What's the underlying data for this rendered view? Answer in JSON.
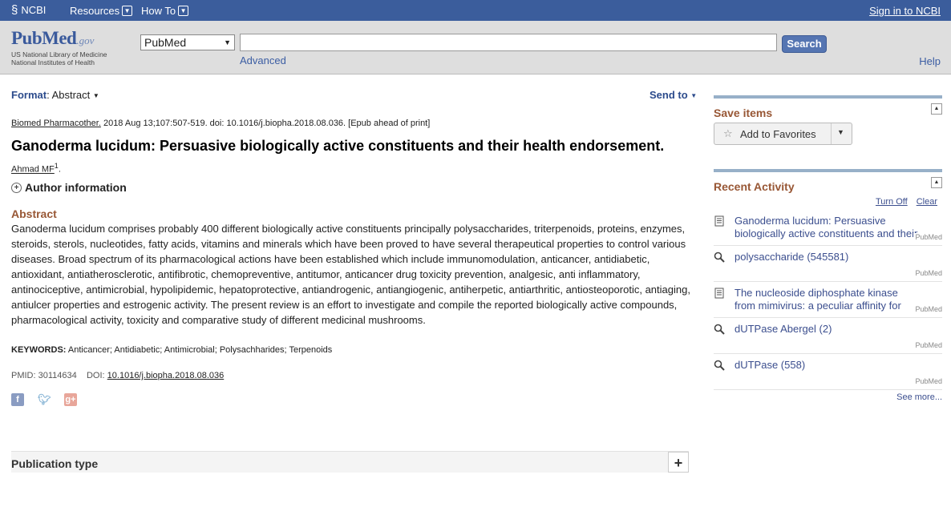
{
  "ncbi_bar": {
    "logo": "NCBI",
    "nav": [
      "Resources",
      "How To"
    ],
    "signin": "Sign in to NCBI"
  },
  "search": {
    "logo_pub": "Pub",
    "logo_med": "Med",
    "logo_gov": ".gov",
    "logo_sub1": "US National Library of Medicine",
    "logo_sub2": "National Institutes of Health",
    "database": "PubMed",
    "query": "",
    "button": "Search",
    "advanced": "Advanced",
    "help": "Help"
  },
  "article": {
    "format_label": "Format",
    "format_value": "Abstract",
    "send_to": "Send to",
    "journal": "Biomed Pharmacother.",
    "citation_rest": "2018 Aug 13;107:507-519. doi: 10.1016/j.biopha.2018.08.036. [Epub ahead of print]",
    "title": "Ganoderma lucidum: Persuasive biologically active constituents and their health endorsement.",
    "author": "Ahmad MF",
    "author_sup": "1",
    "author_info": "Author information",
    "abstract_heading": "Abstract",
    "abstract_text": "Ganoderma lucidum comprises probably 400 different biologically active constituents principally polysaccharides, triterpenoids, proteins, enzymes, steroids, sterols, nucleotides, fatty acids, vitamins and minerals which have been proved to have several therapeutical properties to control various diseases. Broad spectrum of its pharmacological actions have been established which include immunomodulation, anticancer, antidiabetic, antioxidant, antiatherosclerotic, antifibrotic, chemopreventive, antitumor, anticancer drug toxicity prevention, analgesic, anti inflammatory, antinociceptive, antimicrobial, hypolipidemic, hepatoprotective, antiandrogenic, antiangiogenic, antiherpetic, antiarthritic, antiosteoporotic, antiaging, antiulcer properties and estrogenic activity. The present review is an effort to investigate and compile the reported biologically active compounds, pharmacological activity, toxicity and comparative study of different medicinal mushrooms.",
    "keywords_label": "KEYWORDS:",
    "keywords": "Anticancer; Antidiabetic; Antimicrobial; Polysachharides; Terpenoids",
    "pmid_label": "PMID:",
    "pmid": "30114634",
    "doi_label": "DOI:",
    "doi": "10.1016/j.biopha.2018.08.036",
    "publication_type": "Publication type"
  },
  "sidebar": {
    "save_items": "Save items",
    "add_favorites": "Add to Favorites",
    "recent_activity": "Recent Activity",
    "turn_off": "Turn Off",
    "clear": "Clear",
    "items": [
      {
        "type": "doc",
        "text": "Ganoderma lucidum: Persuasive biologically active constituents and their health ...",
        "source": "PubMed"
      },
      {
        "type": "search",
        "text": "polysaccharide (545581)",
        "source": "PubMed"
      },
      {
        "type": "doc",
        "text": "The nucleoside diphosphate kinase from mimivirus: a peculiar affinity for deoxyp",
        "source": "PubMed"
      },
      {
        "type": "search",
        "text": "dUTPase Abergel (2)",
        "source": "PubMed"
      },
      {
        "type": "search",
        "text": "dUTPase (558)",
        "source": "PubMed"
      }
    ],
    "see_more": "See more..."
  }
}
